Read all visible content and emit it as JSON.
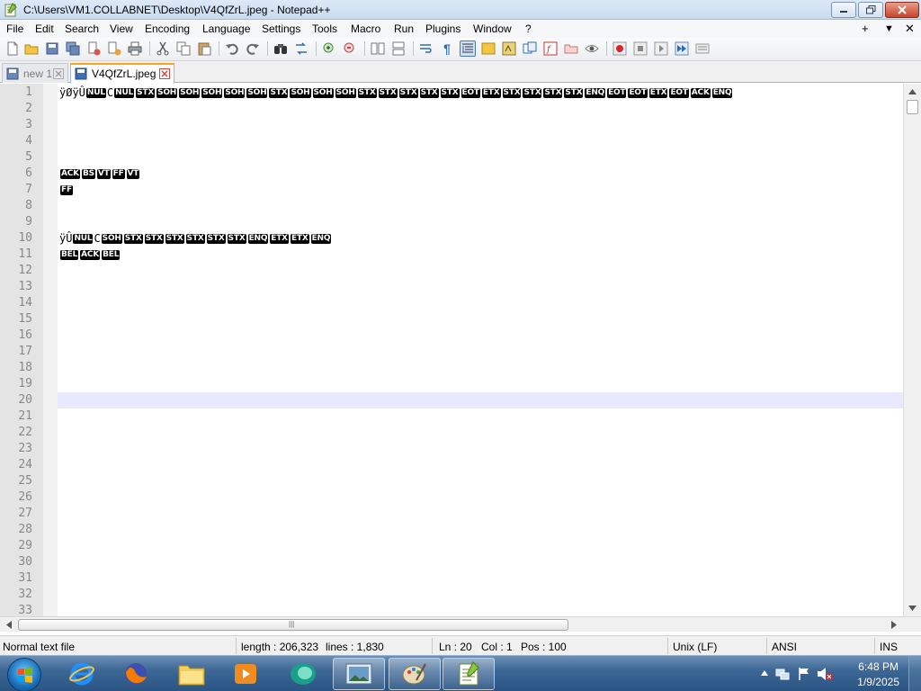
{
  "window": {
    "title": "C:\\Users\\VM1.COLLABNET\\Desktop\\V4QfZrL.jpeg - Notepad++"
  },
  "menu": {
    "items": [
      "File",
      "Edit",
      "Search",
      "View",
      "Encoding",
      "Language",
      "Settings",
      "Tools",
      "Macro",
      "Run",
      "Plugins",
      "Window",
      "?"
    ],
    "right": [
      "+",
      "▼",
      "✕"
    ]
  },
  "tabs": [
    {
      "label": "new 1",
      "active": false
    },
    {
      "label": "V4QfZrL.jpeg",
      "active": true
    }
  ],
  "editor": {
    "line_numbers": [
      "1",
      "2",
      "3",
      "4",
      "5",
      "6",
      "7",
      "8",
      "9",
      "10",
      "11",
      "12",
      "13",
      "14",
      "15",
      "16",
      "17",
      "18",
      "19",
      "20",
      "21",
      "22",
      "23",
      "24",
      "25",
      "26",
      "27",
      "28",
      "29",
      "30",
      "31",
      "32",
      "33"
    ],
    "current_line": 20,
    "lines": {
      "1": [
        {
          "t": "txt",
          "v": "ÿØÿÛ"
        },
        {
          "t": "ctl",
          "v": "NUL"
        },
        {
          "t": "txt",
          "v": "C"
        },
        {
          "t": "ctl",
          "v": "NUL"
        },
        {
          "t": "ctl",
          "v": "STX"
        },
        {
          "t": "ctl",
          "v": "SOH"
        },
        {
          "t": "ctl",
          "v": "SOH"
        },
        {
          "t": "ctl",
          "v": "SOH"
        },
        {
          "t": "ctl",
          "v": "SOH"
        },
        {
          "t": "ctl",
          "v": "SOH"
        },
        {
          "t": "ctl",
          "v": "STX"
        },
        {
          "t": "ctl",
          "v": "SOH"
        },
        {
          "t": "ctl",
          "v": "SOH"
        },
        {
          "t": "ctl",
          "v": "SOH"
        },
        {
          "t": "ctl",
          "v": "STX"
        },
        {
          "t": "ctl",
          "v": "STX"
        },
        {
          "t": "ctl",
          "v": "STX"
        },
        {
          "t": "ctl",
          "v": "STX"
        },
        {
          "t": "ctl",
          "v": "STX"
        },
        {
          "t": "ctl",
          "v": "EOT"
        },
        {
          "t": "ctl",
          "v": "ETX"
        },
        {
          "t": "ctl",
          "v": "STX"
        },
        {
          "t": "ctl",
          "v": "STX"
        },
        {
          "t": "ctl",
          "v": "STX"
        },
        {
          "t": "ctl",
          "v": "STX"
        },
        {
          "t": "ctl",
          "v": "ENQ"
        },
        {
          "t": "ctl",
          "v": "EOT"
        },
        {
          "t": "ctl",
          "v": "EOT"
        },
        {
          "t": "ctl",
          "v": "ETX"
        },
        {
          "t": "ctl",
          "v": "EOT"
        },
        {
          "t": "ctl",
          "v": "ACK"
        },
        {
          "t": "ctl",
          "v": "ENQ"
        }
      ],
      "6": [
        {
          "t": "ctl",
          "v": "ACK"
        },
        {
          "t": "ctl",
          "v": "BS"
        },
        {
          "t": "ctl",
          "v": "VT"
        },
        {
          "t": "ctl",
          "v": "FF"
        },
        {
          "t": "ctl",
          "v": "VT"
        }
      ],
      "7": [
        {
          "t": "ctl",
          "v": "FF"
        }
      ],
      "10": [
        {
          "t": "txt",
          "v": "ÿÛ"
        },
        {
          "t": "ctl",
          "v": "NUL"
        },
        {
          "t": "txt",
          "v": "C"
        },
        {
          "t": "ctl",
          "v": "SOH"
        },
        {
          "t": "ctl",
          "v": "STX"
        },
        {
          "t": "ctl",
          "v": "STX"
        },
        {
          "t": "ctl",
          "v": "STX"
        },
        {
          "t": "ctl",
          "v": "STX"
        },
        {
          "t": "ctl",
          "v": "STX"
        },
        {
          "t": "ctl",
          "v": "STX"
        },
        {
          "t": "ctl",
          "v": "ENQ"
        },
        {
          "t": "ctl",
          "v": "ETX"
        },
        {
          "t": "ctl",
          "v": "ETX"
        },
        {
          "t": "ctl",
          "v": "ENQ"
        }
      ],
      "11": [
        {
          "t": "ctl",
          "v": "BEL"
        },
        {
          "t": "ctl",
          "v": "ACK"
        },
        {
          "t": "ctl",
          "v": "BEL"
        }
      ]
    }
  },
  "status": {
    "file_type": "Normal text file",
    "length": "length : 206,323",
    "lines": "lines : 1,830",
    "ln": "Ln : 20",
    "col": "Col : 1",
    "pos": "Pos : 100",
    "eol": "Unix (LF)",
    "encoding": "ANSI",
    "mode": "INS"
  },
  "taskbar": {
    "time": "6:48 PM",
    "date": "1/9/2025"
  },
  "colors": {
    "current_line_bg": "#e8e8ff",
    "control_char_bg": "#000000",
    "gutter_bg": "#e4e4e4"
  }
}
